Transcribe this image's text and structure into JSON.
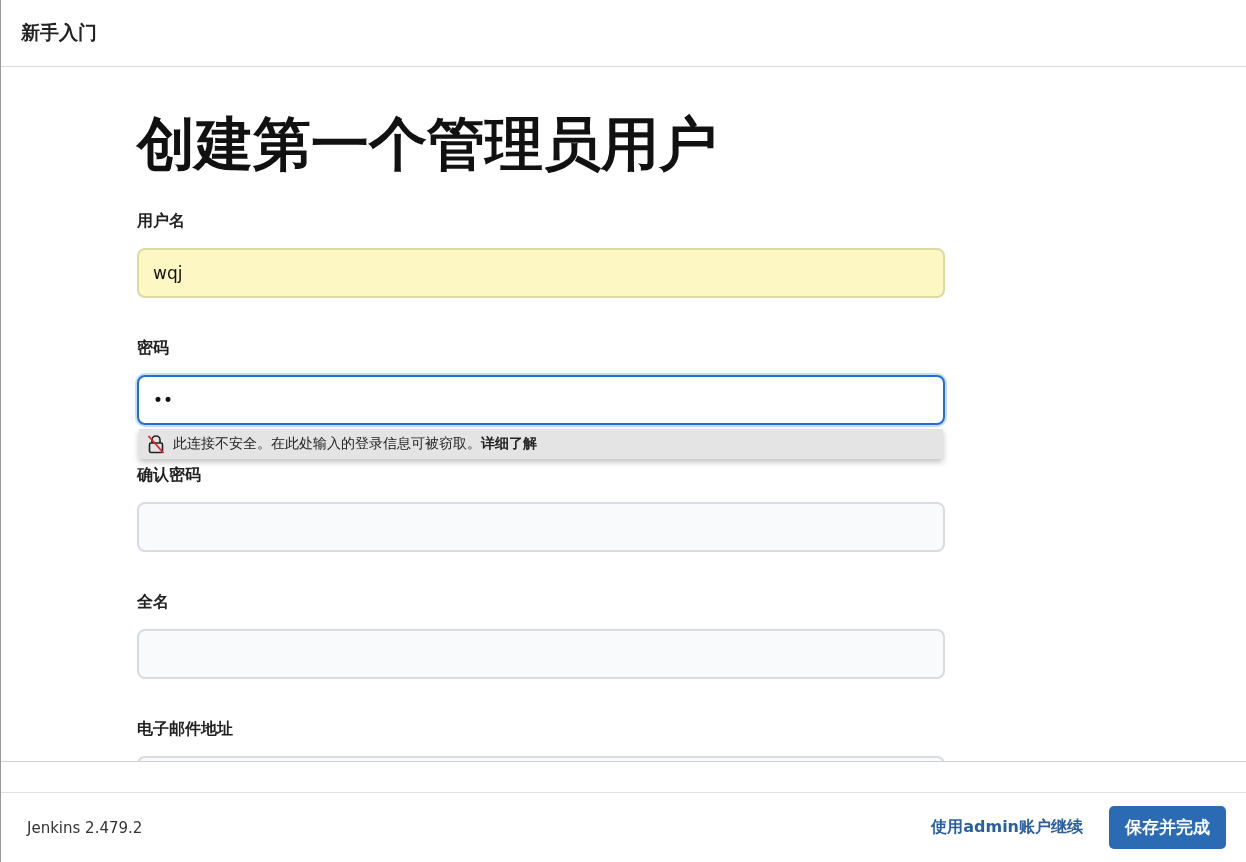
{
  "header": {
    "title": "新手入门"
  },
  "heading": "创建第一个管理员用户",
  "fields": [
    {
      "label": "用户名",
      "value": "wqj",
      "autofilled": true,
      "focused": false
    },
    {
      "label": "密码",
      "value": "••",
      "autofilled": false,
      "focused": true
    },
    {
      "label": "确认密码",
      "autofilled": false,
      "focused": false
    },
    {
      "label": "全名",
      "autofilled": false,
      "focused": false
    },
    {
      "label": "电子邮件地址",
      "autofilled": false,
      "focused": false
    }
  ],
  "warning": {
    "text": "此连接不安全。在此处输入的登录信息可被窃取。",
    "link": "详细了解"
  },
  "footer": {
    "version": "Jenkins 2.479.2",
    "link": "使用admin账户继续",
    "button": "保存并完成"
  }
}
